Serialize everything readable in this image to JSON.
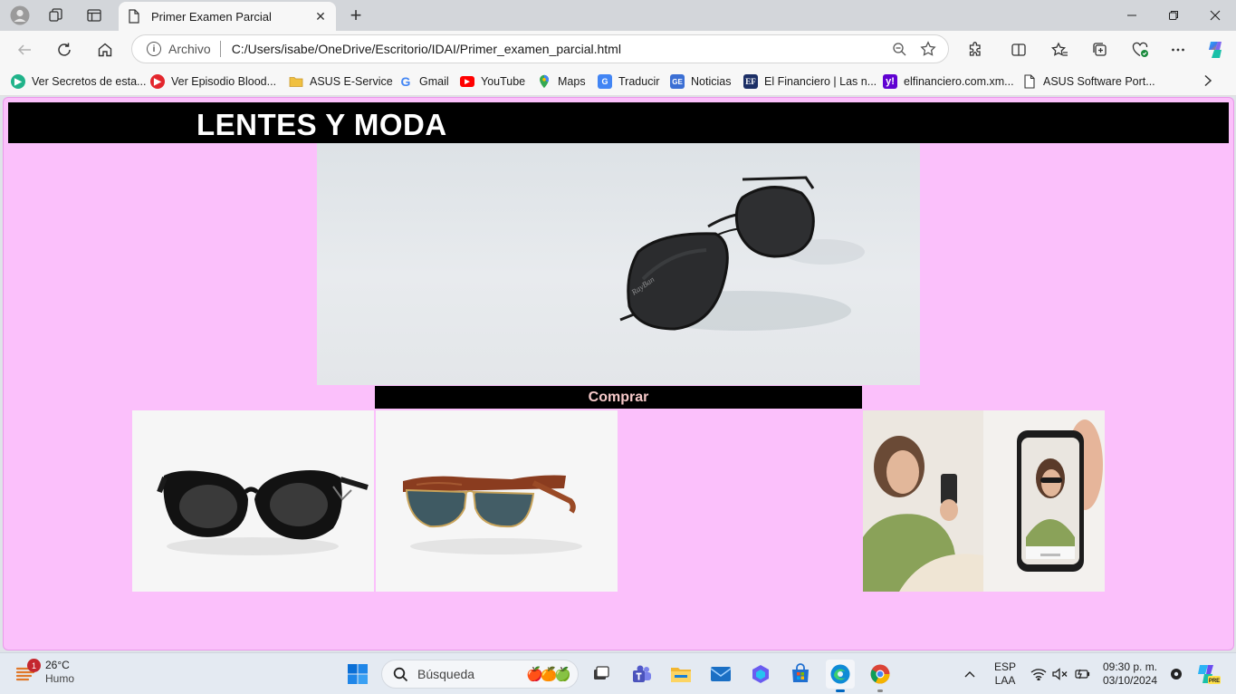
{
  "browser": {
    "tab_title": "Primer Examen Parcial",
    "scheme_label": "Archivo",
    "url": "C:/Users/isabe/OneDrive/Escritorio/IDAI/Primer_examen_parcial.html",
    "bookmarks": [
      {
        "label": "Ver Secretos de esta...",
        "icon": "play-circle-icon",
        "color": "#20b38a"
      },
      {
        "label": "Ver Episodio Blood...",
        "icon": "play-circle-icon",
        "color": "#e3262d"
      },
      {
        "label": "ASUS E-Service",
        "icon": "folder-icon",
        "color": "#f0c040"
      },
      {
        "label": "Gmail",
        "icon": "google-icon",
        "color": "#4285f4"
      },
      {
        "label": "YouTube",
        "icon": "youtube-icon",
        "color": "#ff0000"
      },
      {
        "label": "Maps",
        "icon": "maps-icon",
        "color": "#34a853"
      },
      {
        "label": "Traducir",
        "icon": "translate-icon",
        "color": "#4285f4"
      },
      {
        "label": "Noticias",
        "icon": "news-icon",
        "color": "#3b6fd4"
      },
      {
        "label": "El Financiero | Las n...",
        "icon": "ef-icon",
        "color": "#1c2f66"
      },
      {
        "label": "elfinanciero.com.xm...",
        "icon": "yahoo-icon",
        "color": "#6001d2"
      },
      {
        "label": "ASUS Software Port...",
        "icon": "page-icon",
        "color": "#ffffff"
      }
    ]
  },
  "page": {
    "header_title": "LENTES Y MODA",
    "buy_button": "Comprar",
    "hero_image": "aviator-sunglasses",
    "products": [
      "black-cat-eye-sunglasses",
      "tortoise-clubmaster-sunglasses",
      "virtual-try-on-photo"
    ]
  },
  "taskbar": {
    "temperature": "26°C",
    "weather": "Humo",
    "weather_badge": "1",
    "search_placeholder": "Búsqueda",
    "lang_1": "ESP",
    "lang_2": "LAA",
    "time": "09:30 p. m.",
    "date": "03/10/2024"
  }
}
